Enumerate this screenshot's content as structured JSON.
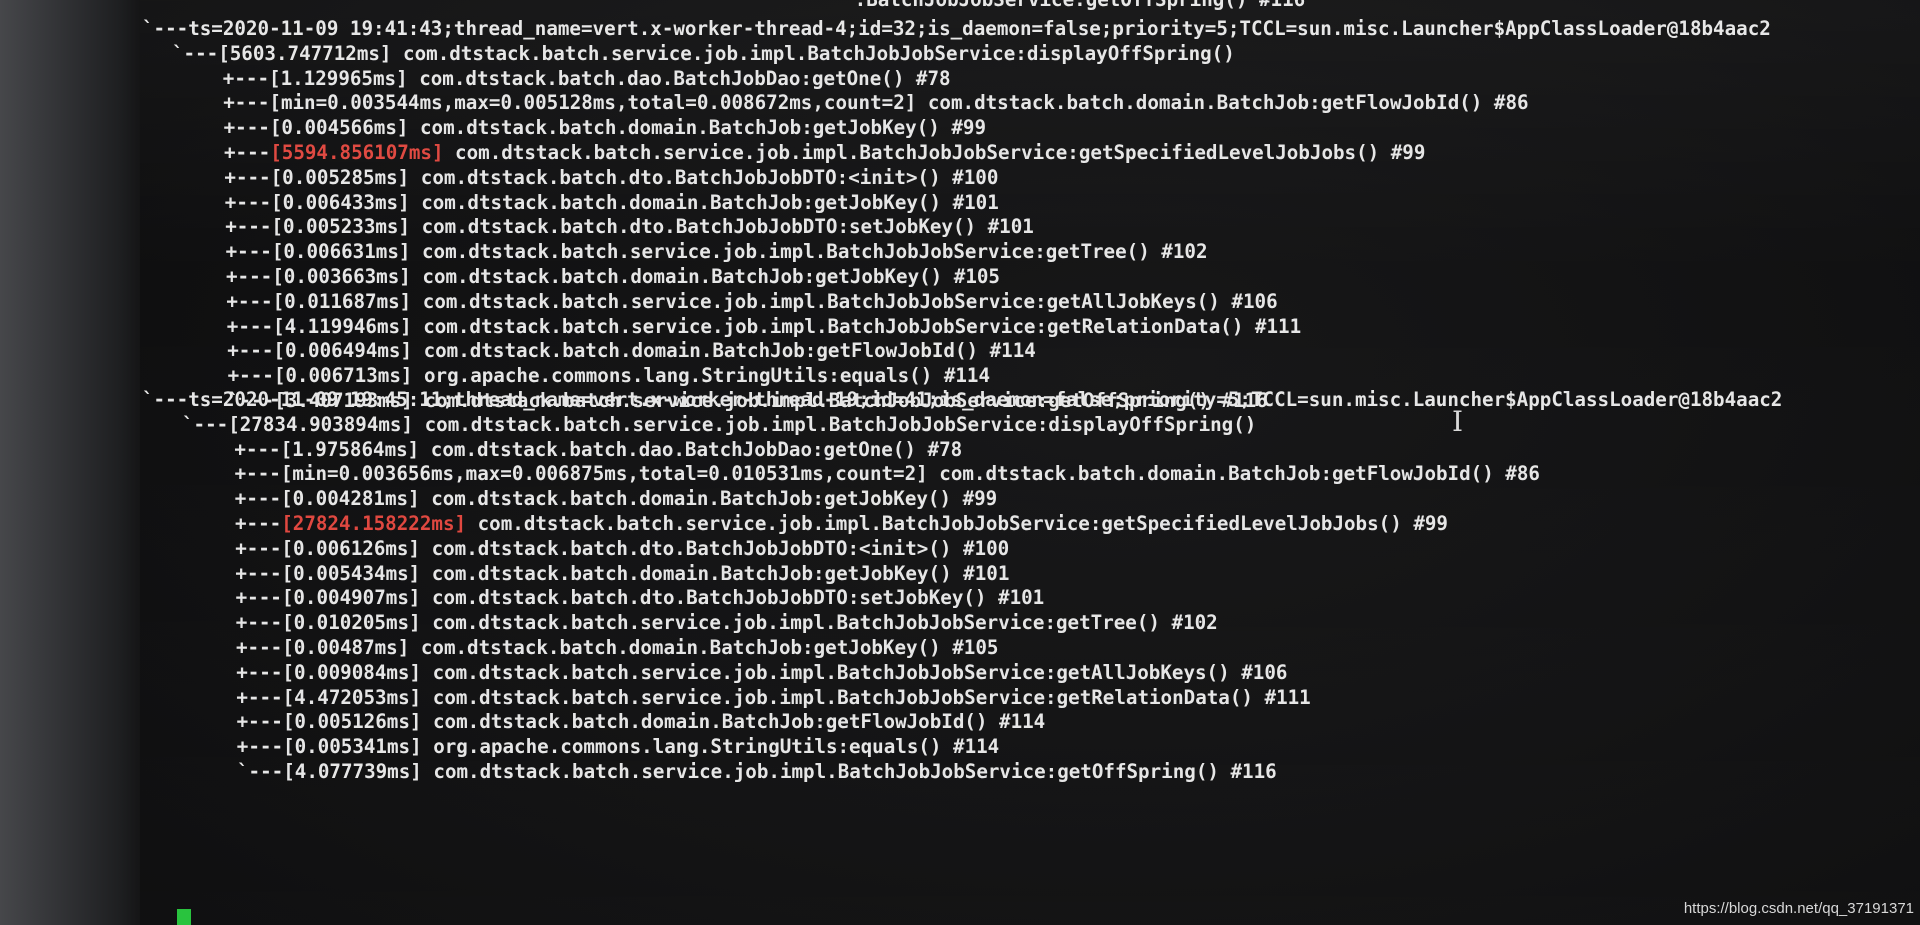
{
  "terminal": {
    "top_partial": "                                                             .BatchJobJobService:getOffSpring() #116",
    "block1": {
      "header": "`---ts=2020-11-09 19:41:43;thread_name=vert.x-worker-thread-4;id=32;is_daemon=false;priority=5;TCCL=sun.misc.Launcher$AppClassLoader@18b4aac2",
      "root": "`---[5603.747712ms] com.dtstack.batch.service.job.impl.BatchJobJobService:displayOffSpring()",
      "rows": [
        {
          "prefix": "+---",
          "time": "[1.129965ms]",
          "hot": false,
          "call": " com.dtstack.batch.dao.BatchJobDao:getOne() #78"
        },
        {
          "prefix": "+---",
          "time": "[min=0.003544ms,max=0.005128ms,total=0.008672ms,count=2]",
          "hot": false,
          "call": " com.dtstack.batch.domain.BatchJob:getFlowJobId() #86"
        },
        {
          "prefix": "+---",
          "time": "[0.004566ms]",
          "hot": false,
          "call": " com.dtstack.batch.domain.BatchJob:getJobKey() #99"
        },
        {
          "prefix": "+---",
          "time": "[5594.856107ms]",
          "hot": true,
          "call": " com.dtstack.batch.service.job.impl.BatchJobJobService:getSpecifiedLevelJobJobs() #99"
        },
        {
          "prefix": "+---",
          "time": "[0.005285ms]",
          "hot": false,
          "call": " com.dtstack.batch.dto.BatchJobJobDTO:<init>() #100"
        },
        {
          "prefix": "+---",
          "time": "[0.006433ms]",
          "hot": false,
          "call": " com.dtstack.batch.domain.BatchJob:getJobKey() #101"
        },
        {
          "prefix": "+---",
          "time": "[0.005233ms]",
          "hot": false,
          "call": " com.dtstack.batch.dto.BatchJobJobDTO:setJobKey() #101"
        },
        {
          "prefix": "+---",
          "time": "[0.006631ms]",
          "hot": false,
          "call": " com.dtstack.batch.service.job.impl.BatchJobJobService:getTree() #102"
        },
        {
          "prefix": "+---",
          "time": "[0.003663ms]",
          "hot": false,
          "call": " com.dtstack.batch.domain.BatchJob:getJobKey() #105"
        },
        {
          "prefix": "+---",
          "time": "[0.011687ms]",
          "hot": false,
          "call": " com.dtstack.batch.service.job.impl.BatchJobJobService:getAllJobKeys() #106"
        },
        {
          "prefix": "+---",
          "time": "[4.119946ms]",
          "hot": false,
          "call": " com.dtstack.batch.service.job.impl.BatchJobJobService:getRelationData() #111"
        },
        {
          "prefix": "+---",
          "time": "[0.006494ms]",
          "hot": false,
          "call": " com.dtstack.batch.domain.BatchJob:getFlowJobId() #114"
        },
        {
          "prefix": "+---",
          "time": "[0.006713ms]",
          "hot": false,
          "call": " org.apache.commons.lang.StringUtils:equals() #114"
        },
        {
          "prefix": "`---",
          "time": "[3.407193ms]",
          "hot": false,
          "call": " com.dtstack.batch.service.job.impl.BatchJobJobService:getOffSpring() #116"
        }
      ]
    },
    "block2": {
      "header": "`---ts=2020-11-09 19:45:11;thread_name=vert.x-worker-thread-19;id=41;is_daemon=false;priority=5;TCCL=sun.misc.Launcher$AppClassLoader@18b4aac2",
      "root": "`---[27834.903894ms] com.dtstack.batch.service.job.impl.BatchJobJobService:displayOffSpring()",
      "rows": [
        {
          "prefix": "+---",
          "time": "[1.975864ms]",
          "hot": false,
          "call": " com.dtstack.batch.dao.BatchJobDao:getOne() #78"
        },
        {
          "prefix": "+---",
          "time": "[min=0.003656ms,max=0.006875ms,total=0.010531ms,count=2]",
          "hot": false,
          "call": " com.dtstack.batch.domain.BatchJob:getFlowJobId() #86"
        },
        {
          "prefix": "+---",
          "time": "[0.004281ms]",
          "hot": false,
          "call": " com.dtstack.batch.domain.BatchJob:getJobKey() #99"
        },
        {
          "prefix": "+---",
          "time": "[27824.158222ms]",
          "hot": true,
          "call": " com.dtstack.batch.service.job.impl.BatchJobJobService:getSpecifiedLevelJobJobs() #99"
        },
        {
          "prefix": "+---",
          "time": "[0.006126ms]",
          "hot": false,
          "call": " com.dtstack.batch.dto.BatchJobJobDTO:<init>() #100"
        },
        {
          "prefix": "+---",
          "time": "[0.005434ms]",
          "hot": false,
          "call": " com.dtstack.batch.domain.BatchJob:getJobKey() #101"
        },
        {
          "prefix": "+---",
          "time": "[0.004907ms]",
          "hot": false,
          "call": " com.dtstack.batch.dto.BatchJobJobDTO:setJobKey() #101"
        },
        {
          "prefix": "+---",
          "time": "[0.010205ms]",
          "hot": false,
          "call": " com.dtstack.batch.service.job.impl.BatchJobJobService:getTree() #102"
        },
        {
          "prefix": "+---",
          "time": "[0.00487ms]",
          "hot": false,
          "call": " com.dtstack.batch.domain.BatchJob:getJobKey() #105"
        },
        {
          "prefix": "+---",
          "time": "[0.009084ms]",
          "hot": false,
          "call": " com.dtstack.batch.service.job.impl.BatchJobJobService:getAllJobKeys() #106"
        },
        {
          "prefix": "+---",
          "time": "[4.472053ms]",
          "hot": false,
          "call": " com.dtstack.batch.service.job.impl.BatchJobJobService:getRelationData() #111"
        },
        {
          "prefix": "+---",
          "time": "[0.005126ms]",
          "hot": false,
          "call": " com.dtstack.batch.domain.BatchJob:getFlowJobId() #114"
        },
        {
          "prefix": "+---",
          "time": "[0.005341ms]",
          "hot": false,
          "call": " org.apache.commons.lang.StringUtils:equals() #114"
        },
        {
          "prefix": "`---",
          "time": "[4.077739ms]",
          "hot": false,
          "call": " com.dtstack.batch.service.job.impl.BatchJobJobService:getOffSpring() #116"
        }
      ]
    }
  },
  "colors": {
    "text": "#e6e6e6",
    "highlight": "#e0473f",
    "cursor": "#25c23a"
  },
  "icons": {
    "mouse_cursor": "text-ibeam-cursor-icon"
  },
  "ibeam_glyph": "I",
  "watermark": "https://blog.csdn.net/qq_37191371"
}
